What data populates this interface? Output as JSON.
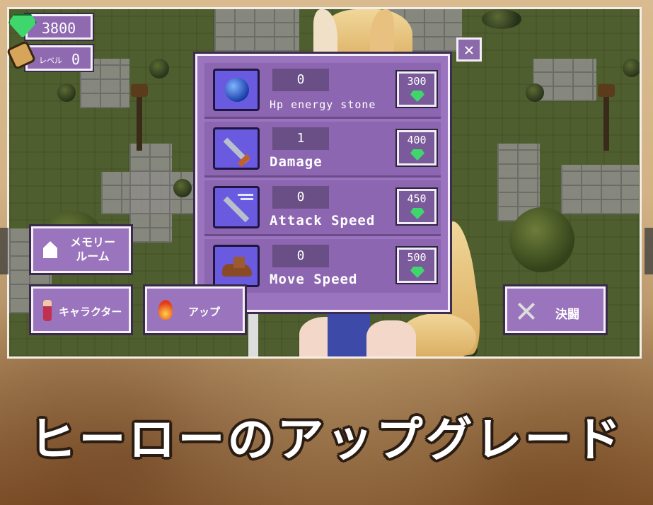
{
  "hud": {
    "gems": "3800",
    "level_label": "レベル",
    "level_value": "0",
    "gem_icon": "green-gem-icon",
    "level_icon": "scroll-icon"
  },
  "close_label": "✕",
  "upgrades": [
    {
      "icon": "blue-orb-icon",
      "count": "0",
      "name": "Hp energy stone",
      "cost": "300"
    },
    {
      "icon": "sword-icon",
      "count": "1",
      "name": "Damage",
      "cost": "400"
    },
    {
      "icon": "swift-sword-icon",
      "count": "0",
      "name": "Attack Speed",
      "cost": "450"
    },
    {
      "icon": "boot-icon",
      "count": "0",
      "name": "Move Speed",
      "cost": "500"
    }
  ],
  "menu": {
    "memory_room": "メモリー\nルーム",
    "memory_room_l1": "メモリー",
    "memory_room_l2": "ルーム",
    "character": "キャラクター",
    "upgrade": "アップ",
    "duel": "決闘"
  },
  "caption": "ヒーローのアップグレード",
  "colors": {
    "panel": "#9b74bf",
    "gem": "#3ed66d",
    "icon_bg": "#6a5ae0"
  }
}
